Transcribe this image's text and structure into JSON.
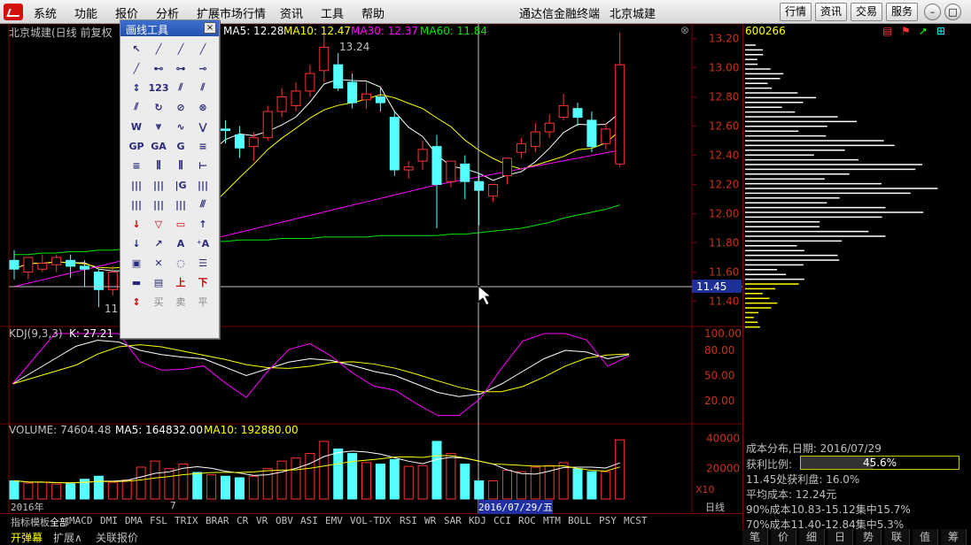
{
  "menubar": {
    "items": [
      "系统",
      "功能",
      "报价",
      "分析",
      "扩展市场行情",
      "资讯",
      "工具",
      "帮助"
    ],
    "app_title": "通达信金融终端",
    "stock_name": "北京城建",
    "right_buttons": [
      "行情",
      "资讯",
      "交易",
      "服务"
    ]
  },
  "chart_header": {
    "title": "北京城建(日线 前复权",
    "ma5": "MA5: 12.28",
    "ma10": "MA10: 12.47",
    "ma30": "MA30: 12.37",
    "ma60": "MA60: 11.84",
    "high_label": "13.24",
    "low_label": "11",
    "price_ticks": [
      "13.20",
      "13.00",
      "12.80",
      "12.60",
      "12.40",
      "12.20",
      "12.00",
      "11.80",
      "11.60",
      "11.40"
    ],
    "crosshair_price": "11.45"
  },
  "kdj": {
    "label": "KDJ(9,3,3)",
    "k": "K: 27.21",
    "ticks": [
      "100.00",
      "80.00",
      "50.00",
      "20.00"
    ]
  },
  "volume": {
    "label": "VOLUME: 74604.48",
    "ma5": "MA5: 164832.00",
    "ma10": "MA10: 192880.00",
    "ticks": [
      "40000",
      "20000"
    ],
    "multiplier": "X10"
  },
  "date_axis": {
    "year": "2016年",
    "month": "7",
    "crosshair_date": "2016/07/29/五",
    "period": "日线"
  },
  "tool_panel": {
    "title": "画线工具",
    "close": "×",
    "cells": [
      "↖",
      "╱",
      "╱",
      "╱",
      "╱",
      "⊷",
      "⊶",
      "⊸",
      "↕",
      "123",
      "⫽",
      "⫽",
      "⫽",
      "↻",
      "⊘",
      "⊗",
      "W",
      "⩔",
      "∿",
      "⋁",
      "GP",
      "GA",
      "G",
      "≡",
      "≡",
      "⫼",
      "⫼",
      "⊢",
      "|||",
      "|||",
      "|G",
      "|||",
      "|||",
      "|||",
      "|||",
      "⫻",
      "↓",
      "▽",
      "▭",
      "↑",
      "↓",
      "↗",
      "A",
      "⁺A",
      "▣",
      "✕",
      "◌",
      "☰",
      "▬",
      "▤",
      "上",
      "下",
      "↕",
      "买",
      "卖",
      "平"
    ]
  },
  "side_panel": {
    "code": "600266",
    "cost_title": "成本分布,日期: 2016/07/29",
    "profit_ratio_label": "获利比例:",
    "profit_ratio": "45.6%",
    "profit_at_price": "11.45处获利盘: 16.0%",
    "avg_cost": "平均成本: 12.24元",
    "cost90": "90%成本10.83-15.12集中15.7%",
    "cost70": "70%成本11.40-12.84集中5.3%"
  },
  "bottom_tabs": [
    "指标",
    "模板",
    "全部",
    "MACD",
    "DMI",
    "DMA",
    "FSL",
    "TRIX",
    "BRAR",
    "CR",
    "VR",
    "OBV",
    "ASI",
    "EMV",
    "VOL-TDX",
    "RSI",
    "WR",
    "SAR",
    "KDJ",
    "CCI",
    "ROC",
    "MTM",
    "BOLL",
    "PSY",
    "MCST"
  ],
  "status_items": [
    "开弹幕",
    "扩展∧",
    "关联报价"
  ],
  "right_tabs": [
    "笔",
    "价",
    "细",
    "日",
    "势",
    "联",
    "值",
    "筹"
  ],
  "colors": {
    "up": "#ff3232",
    "down": "#54ffff",
    "ma5": "#ffffff",
    "ma10": "#ffff00",
    "ma30": "#ff00ff",
    "ma60": "#00e600",
    "grid": "#7a0000"
  },
  "chart_data": {
    "type": "candlestick",
    "candles": [
      [
        11.68,
        11.75,
        11.62,
        11.55
      ],
      [
        11.6,
        11.66,
        11.7,
        11.55
      ],
      [
        11.62,
        11.72,
        11.66,
        11.6
      ],
      [
        11.65,
        11.72,
        11.7,
        11.6
      ],
      [
        11.68,
        11.72,
        11.64,
        11.56
      ],
      [
        11.64,
        11.68,
        11.62,
        11.5
      ],
      [
        11.6,
        11.62,
        11.48,
        11.36
      ],
      [
        11.48,
        11.64,
        11.6,
        11.44
      ],
      [
        11.6,
        11.72,
        11.7,
        11.56
      ],
      [
        11.9,
        12.1,
        12.02,
        11.86
      ],
      [
        12.02,
        12.22,
        12.16,
        12.0
      ],
      [
        12.16,
        12.3,
        12.26,
        12.1
      ],
      [
        12.3,
        12.62,
        12.58,
        12.28
      ],
      [
        12.56,
        12.64,
        12.55,
        12.48
      ],
      [
        12.55,
        12.62,
        12.58,
        12.5
      ],
      [
        12.58,
        12.64,
        12.57,
        12.48
      ],
      [
        12.54,
        12.6,
        12.45,
        12.38
      ],
      [
        12.46,
        12.56,
        12.52,
        12.36
      ],
      [
        12.52,
        12.74,
        12.7,
        12.5
      ],
      [
        12.7,
        12.86,
        12.8,
        12.66
      ],
      [
        12.74,
        12.9,
        12.84,
        12.7
      ],
      [
        12.84,
        13.02,
        12.96,
        12.8
      ],
      [
        12.98,
        13.24,
        13.14,
        12.9
      ],
      [
        13.02,
        13.1,
        12.86,
        12.84
      ],
      [
        12.9,
        12.96,
        12.76,
        12.72
      ],
      [
        12.78,
        12.9,
        12.82,
        12.72
      ],
      [
        12.8,
        12.86,
        12.76,
        12.7
      ],
      [
        12.66,
        12.7,
        12.3,
        12.26
      ],
      [
        12.3,
        12.36,
        12.32,
        12.24
      ],
      [
        12.36,
        12.5,
        12.44,
        12.3
      ],
      [
        12.46,
        12.54,
        12.2,
        11.9
      ],
      [
        12.22,
        12.26,
        12.36,
        12.18
      ],
      [
        12.34,
        12.4,
        12.22,
        12.1
      ],
      [
        12.22,
        12.28,
        12.16,
        11.92
      ],
      [
        12.12,
        12.2,
        12.2,
        12.08
      ],
      [
        12.26,
        12.34,
        12.38,
        12.2
      ],
      [
        12.42,
        12.52,
        12.48,
        12.38
      ],
      [
        12.46,
        12.62,
        12.56,
        12.42
      ],
      [
        12.56,
        12.68,
        12.62,
        12.52
      ],
      [
        12.66,
        12.82,
        12.74,
        12.64
      ],
      [
        12.72,
        12.76,
        12.66,
        12.6
      ],
      [
        12.64,
        12.7,
        12.46,
        12.42
      ],
      [
        12.48,
        12.62,
        12.58,
        12.44
      ],
      [
        12.34,
        13.24,
        13.02,
        12.32
      ]
    ],
    "ma60": [
      11.72,
      11.72,
      11.73,
      11.73,
      11.74,
      11.74,
      11.75,
      11.75,
      11.76,
      11.77,
      11.78,
      11.79,
      11.8,
      11.8,
      11.81,
      11.81,
      11.82,
      11.82,
      11.82,
      11.83,
      11.83,
      11.83,
      11.84,
      11.84,
      11.84,
      11.84,
      11.85,
      11.85,
      11.85,
      11.85,
      11.85,
      11.86,
      11.86,
      11.87,
      11.88,
      11.89,
      11.9,
      11.92,
      11.94,
      11.97,
      11.99,
      12.01,
      12.03,
      12.06
    ],
    "volumes": [
      12000,
      10500,
      11000,
      9800,
      10000,
      13000,
      15000,
      11000,
      12500,
      21000,
      25000,
      20000,
      23000,
      17500,
      16000,
      15000,
      14000,
      15000,
      20000,
      25000,
      27000,
      30000,
      38000,
      33000,
      30000,
      24000,
      23000,
      26000,
      21500,
      22000,
      38000,
      30000,
      23000,
      12000,
      12000,
      19000,
      18000,
      21000,
      22000,
      24000,
      20000,
      18000,
      18000,
      39000
    ]
  }
}
